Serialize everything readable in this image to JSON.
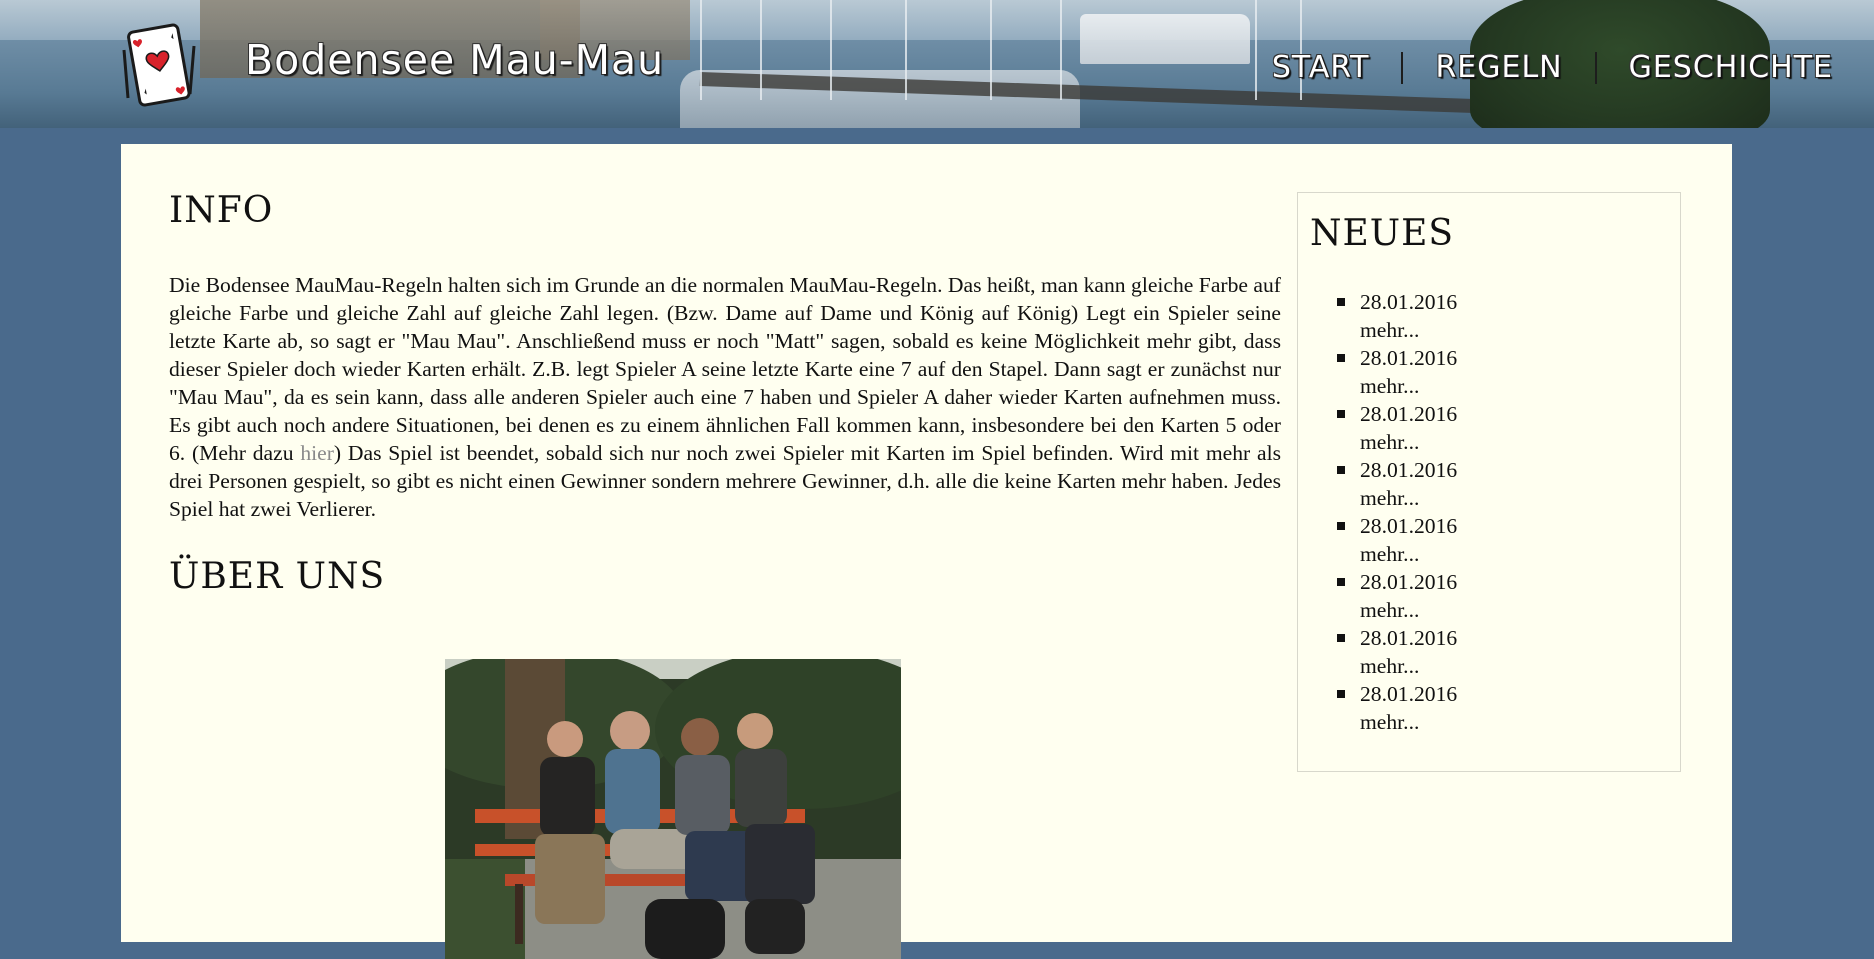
{
  "header": {
    "site_title": "Bodensee Mau-Mau",
    "nav": [
      {
        "label": "START"
      },
      {
        "label": "REGELN"
      },
      {
        "label": "GESCHICHTE"
      }
    ]
  },
  "main": {
    "info_heading": "INFO",
    "info_text_before_link": "Die Bodensee MauMau-Regeln halten sich im Grunde an die normalen MauMau-Regeln. Das heißt, man kann gleiche Farbe auf gleiche Farbe und gleiche Zahl auf gleiche Zahl legen. (Bzw. Dame auf Dame und König auf Kö­nig) Legt ein Spieler seine letzte Karte ab, so sagt er \"Mau Mau\". Anschließend muss er noch \"Matt\" sagen, so­bald es keine Möglichkeit mehr gibt, dass dieser Spieler doch wieder Karten erhält. Z.B. legt Spieler A seine letz­te Karte eine 7 auf den Stapel. Dann sagt er zunächst nur \"Mau Mau\", da es sein kann, dass alle anderen Spieler auch eine 7 haben und Spieler A daher wieder Karten aufnehmen muss. Es gibt auch noch andere Situationen, bei denen es zu einem ähnlichen Fall kommen kann, insbesondere bei den Karten 5 oder 6. (Mehr dazu ",
    "info_link": "hier",
    "info_text_after_link": ") Das Spiel ist beendet, sobald sich nur noch zwei Spieler mit Karten im Spiel befinden. Wird mit mehr als drei Perso­nen gespielt, so gibt es nicht einen Gewinner sondern mehrere Gewinner, d.h. alle die keine Karten mehr haben. Jedes Spiel hat zwei Verlierer.",
    "about_heading": "ÜBER UNS"
  },
  "sidebar": {
    "heading": "NEUES",
    "items": [
      {
        "date": "28.01.2016",
        "more": "mehr..."
      },
      {
        "date": "28.01.2016",
        "more": "mehr..."
      },
      {
        "date": "28.01.2016",
        "more": "mehr..."
      },
      {
        "date": "28.01.2016",
        "more": "mehr..."
      },
      {
        "date": "28.01.2016",
        "more": "mehr..."
      },
      {
        "date": "28.01.2016",
        "more": "mehr..."
      },
      {
        "date": "28.01.2016",
        "more": "mehr..."
      },
      {
        "date": "28.01.2016",
        "more": "mehr..."
      }
    ]
  },
  "colors": {
    "background": "#4a6a8c",
    "content_background": "#fffff0",
    "link_gray": "#8a8a8a",
    "card_heart": "#d8222b"
  },
  "icons": [
    "playing-card-logo-icon"
  ]
}
